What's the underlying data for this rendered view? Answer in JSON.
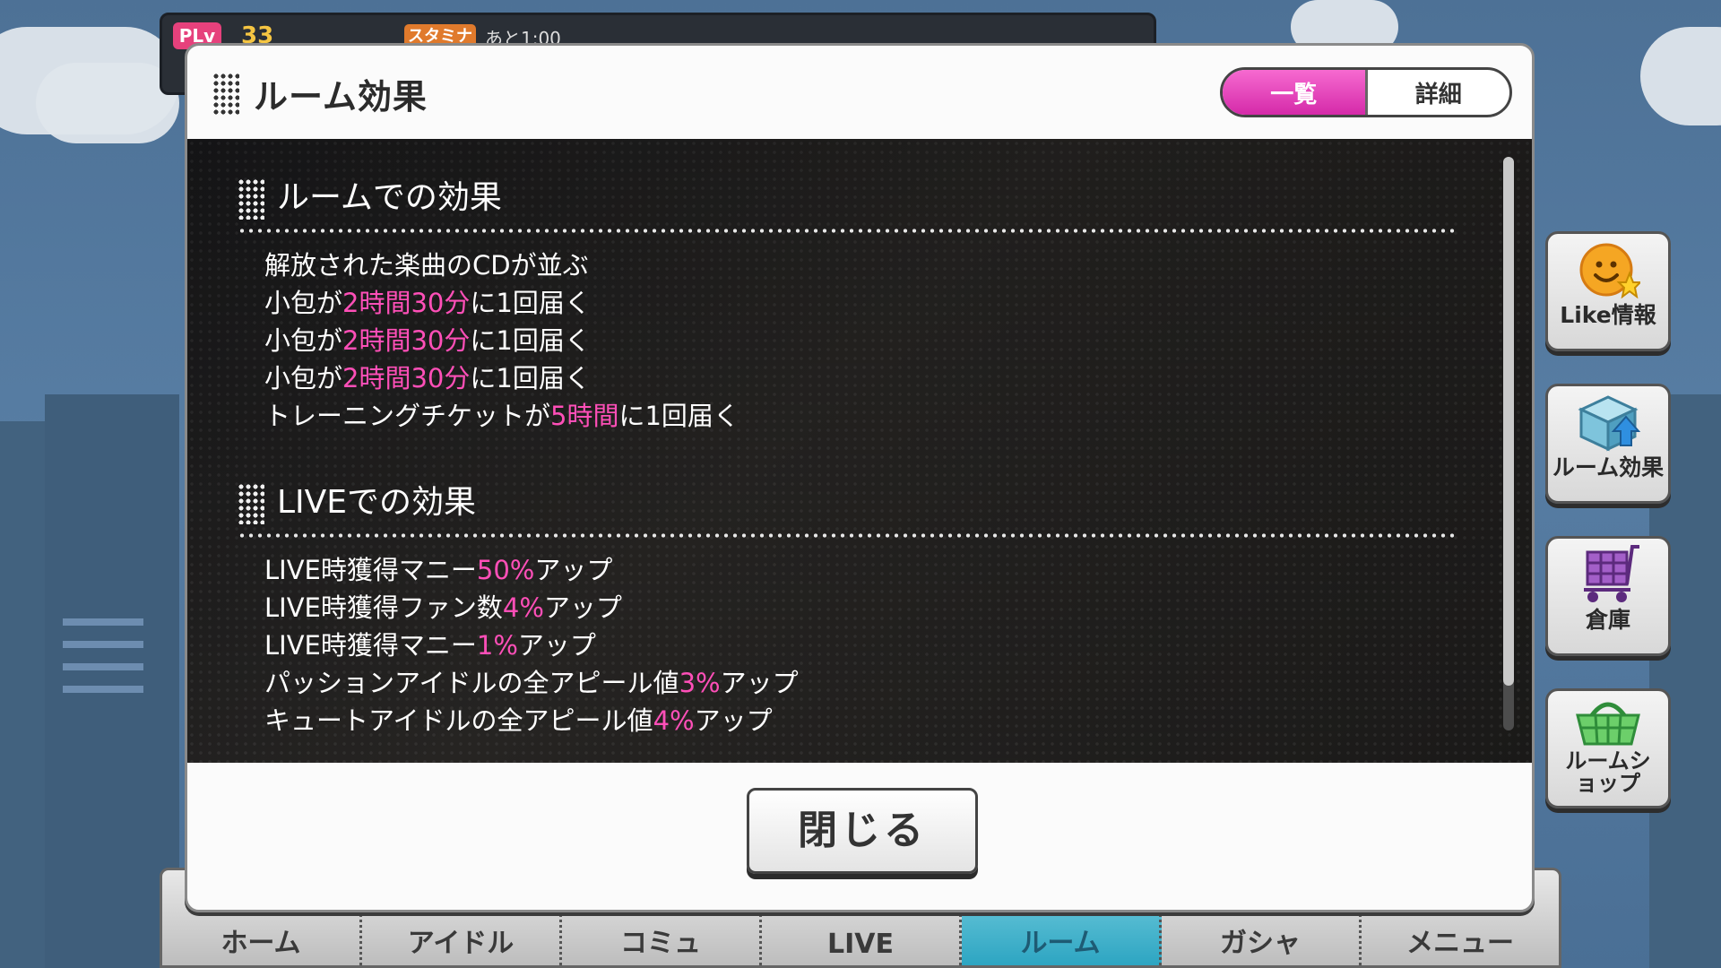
{
  "status": {
    "lv_label": "PLv",
    "lv_value": "33",
    "stamina_label": "スタミナ",
    "stamina_time": "あと1:00"
  },
  "dialog": {
    "title": "ルーム効果",
    "tabs": [
      {
        "label": "一覧",
        "active": true
      },
      {
        "label": "詳細",
        "active": false
      }
    ],
    "close_label": "閉じる"
  },
  "sections": [
    {
      "title": "ルームでの効果",
      "effects": [
        {
          "parts": [
            {
              "text": "解放された楽曲のCDが並ぶ",
              "hl": false
            }
          ]
        },
        {
          "parts": [
            {
              "text": "小包が",
              "hl": false
            },
            {
              "text": "2時間30分",
              "hl": true
            },
            {
              "text": "に1回届く",
              "hl": false
            }
          ]
        },
        {
          "parts": [
            {
              "text": "小包が",
              "hl": false
            },
            {
              "text": "2時間30分",
              "hl": true
            },
            {
              "text": "に1回届く",
              "hl": false
            }
          ]
        },
        {
          "parts": [
            {
              "text": "小包が",
              "hl": false
            },
            {
              "text": "2時間30分",
              "hl": true
            },
            {
              "text": "に1回届く",
              "hl": false
            }
          ]
        },
        {
          "parts": [
            {
              "text": "トレーニングチケットが",
              "hl": false
            },
            {
              "text": "5時間",
              "hl": true
            },
            {
              "text": "に1回届く",
              "hl": false
            }
          ]
        }
      ]
    },
    {
      "title": "LIVEでの効果",
      "effects": [
        {
          "parts": [
            {
              "text": "LIVE時獲得マニー",
              "hl": false
            },
            {
              "text": "50%",
              "hl": true
            },
            {
              "text": "アップ",
              "hl": false
            }
          ]
        },
        {
          "parts": [
            {
              "text": "LIVE時獲得ファン数",
              "hl": false
            },
            {
              "text": "4%",
              "hl": true
            },
            {
              "text": "アップ",
              "hl": false
            }
          ]
        },
        {
          "parts": [
            {
              "text": "LIVE時獲得マニー",
              "hl": false
            },
            {
              "text": "1%",
              "hl": true
            },
            {
              "text": "アップ",
              "hl": false
            }
          ]
        },
        {
          "parts": [
            {
              "text": "パッションアイドルの全アピール値",
              "hl": false
            },
            {
              "text": "3%",
              "hl": true
            },
            {
              "text": "アップ",
              "hl": false
            }
          ]
        },
        {
          "parts": [
            {
              "text": "キュートアイドルの全アピール値",
              "hl": false
            },
            {
              "text": "4%",
              "hl": true
            },
            {
              "text": "アップ",
              "hl": false
            }
          ]
        }
      ]
    }
  ],
  "side_buttons": [
    {
      "label": "Like情報",
      "icon": "smiley-star-icon"
    },
    {
      "label": "ルーム効果",
      "icon": "room-box-arrow-icon"
    },
    {
      "label": "倉庫",
      "icon": "cart-icon"
    },
    {
      "label": "ルームショップ",
      "icon": "basket-icon"
    }
  ],
  "nav": [
    {
      "label": "ホーム",
      "active": false
    },
    {
      "label": "アイドル",
      "active": false
    },
    {
      "label": "コミュ",
      "active": false
    },
    {
      "label": "LIVE",
      "active": false
    },
    {
      "label": "ルーム",
      "active": true
    },
    {
      "label": "ガシャ",
      "active": false
    },
    {
      "label": "メニュー",
      "active": false
    }
  ],
  "colors": {
    "highlight": "#ff4fb8",
    "tab_active": "#e040b8",
    "sky": "#577da3"
  }
}
